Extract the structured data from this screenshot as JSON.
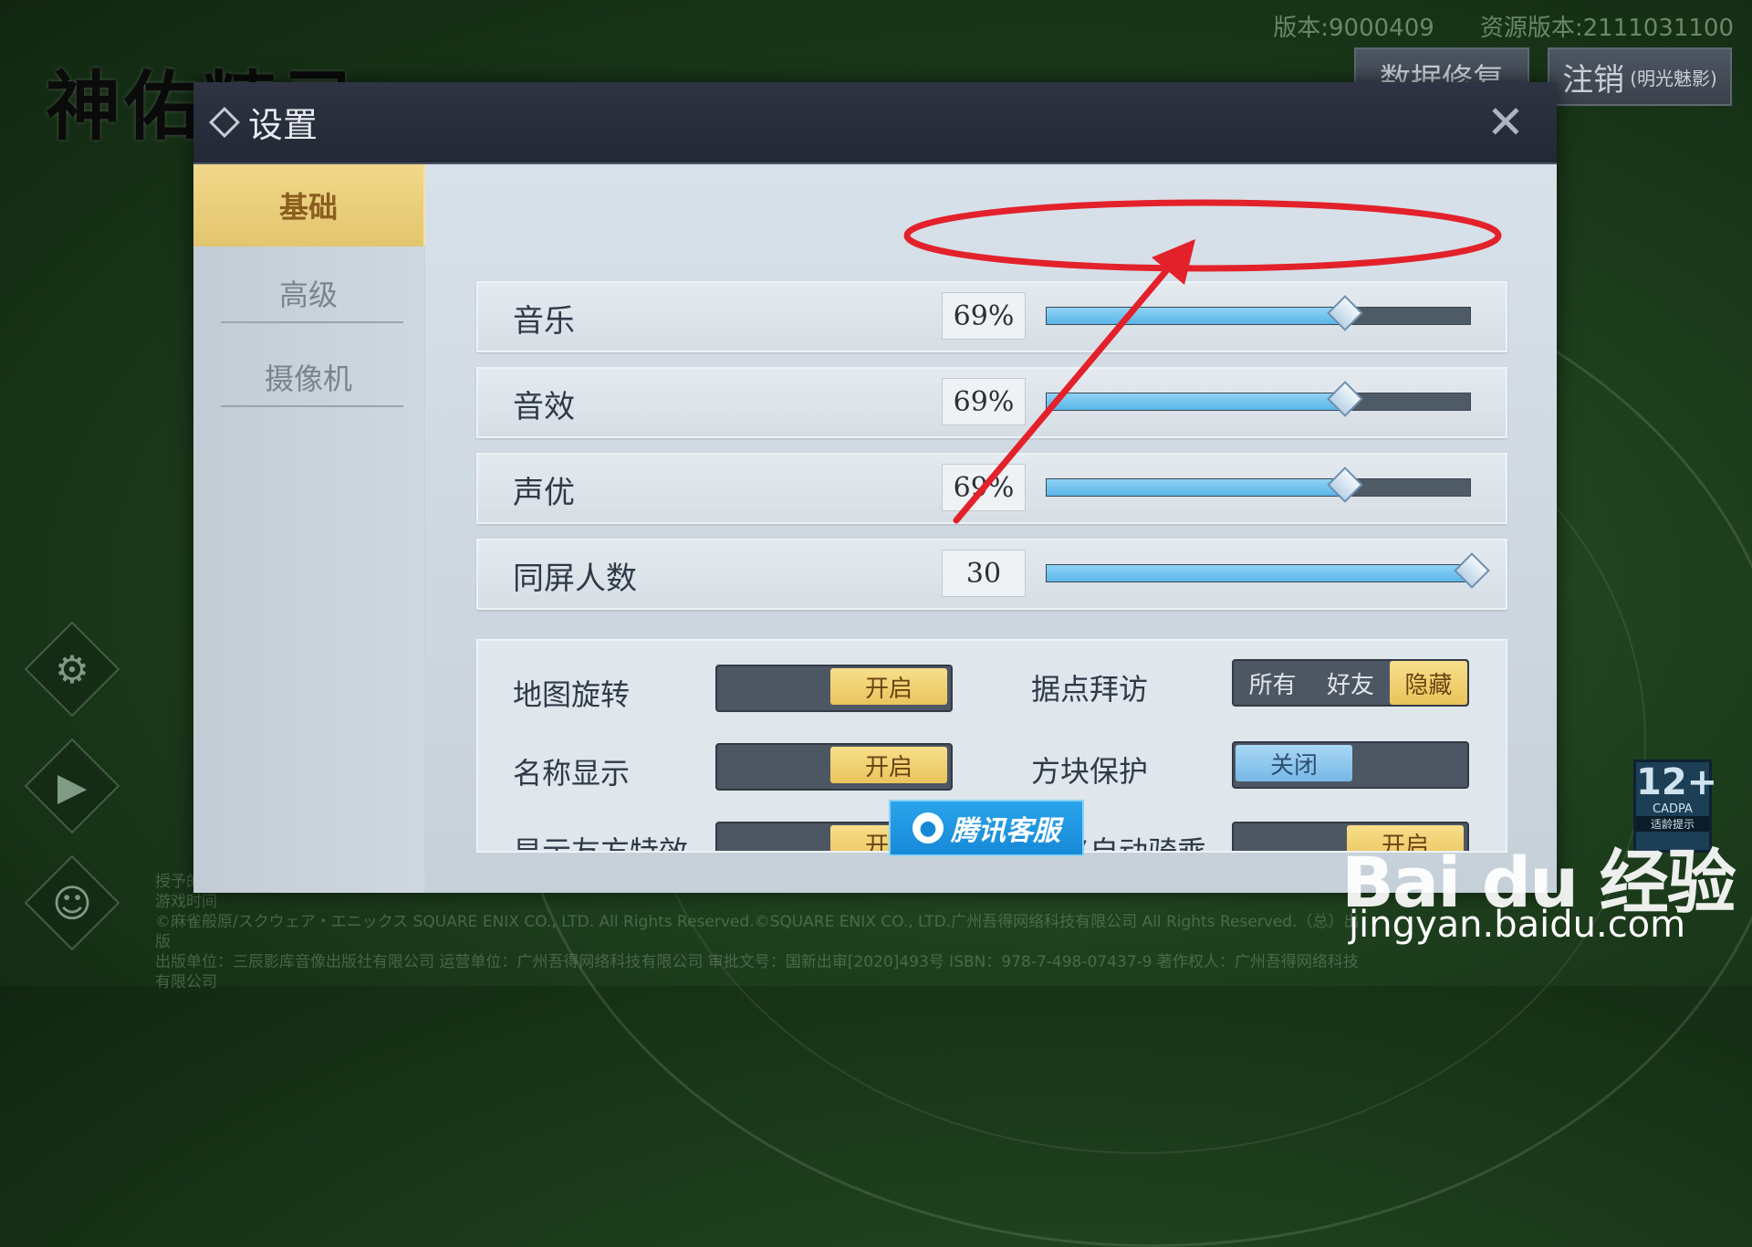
{
  "background": {
    "version_label": "版本:9000409",
    "resource_version_label": "资源版本:2111031100",
    "repair_button": "数据修复",
    "logout_button": "注销",
    "logout_sub": "(明光魅影)",
    "logo_text": "神佑精灵",
    "footer_lines": [
      "授予的版本开宣旅游者机遇回的（2）适宜年龄：本游戏适合年满12周岁以上的用户使用（年龄至无明显延伸适宜）；请随确定已获无进行实名注册，为了您的健康，请合理控制游戏时间",
      "©麻雀般原/スクウェア・エニックス SQUARE ENIX CO., LTD. All Rights Reserved.©SQUARE ENIX CO., LTD.广州吾得网络科技有限公司 All Rights Reserved.（总）出版",
      "出版单位：三辰影库音像出版社有限公司 运营单位：广州吾得网络科技有限公司 审批文号：国新出审[2020]493号 ISBN：978-7-498-07437-9 著作权人：广州吾得网络科技有限公司"
    ],
    "age_rating": "12+",
    "age_rating_org": "CADPA",
    "age_rating_note": "适龄提示"
  },
  "watermark": {
    "brand": "Bai du 经验",
    "url": "jingyan.baidu.com"
  },
  "dialog": {
    "title": "设置",
    "nav": [
      "基础",
      "高级",
      "摄像机"
    ],
    "sliders": [
      {
        "label": "音乐",
        "display": "69%",
        "fraction": 0.7
      },
      {
        "label": "音效",
        "display": "69%",
        "fraction": 0.7
      },
      {
        "label": "声优",
        "display": "69%",
        "fraction": 0.7
      },
      {
        "label": "同屏人数",
        "display": "30",
        "fraction": 1.0
      }
    ],
    "toggles": {
      "map_rotation": {
        "label": "地图旋转",
        "state": "开启"
      },
      "name_display": {
        "label": "名称显示",
        "state": "开启"
      },
      "friend_effects": {
        "label": "显示友方特效",
        "state": "开启"
      },
      "stronghold_visit": {
        "label": "据点拜访",
        "options": [
          "所有",
          "好友",
          "隐藏"
        ],
        "selected": "隐藏"
      },
      "block_protection": {
        "label": "方块保护",
        "state": "关闭"
      },
      "auto_mount": {
        "label": "寻路自动骑乘",
        "state": "开启"
      }
    },
    "service_button": "腾讯客服"
  },
  "colors": {
    "accent_gold": "#e9c45c",
    "slider_fill": "#5ab6e8",
    "annotation_red": "#e3212b"
  }
}
